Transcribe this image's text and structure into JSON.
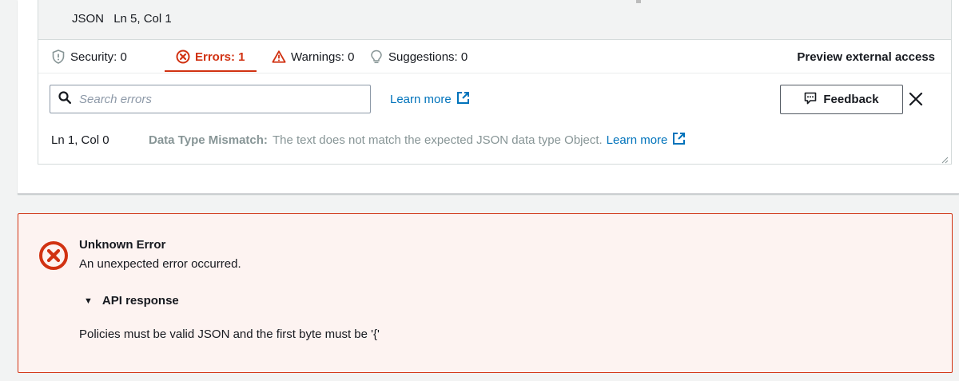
{
  "editor_status": {
    "language": "JSON",
    "cursor": "Ln 5, Col 1"
  },
  "tabs": [
    {
      "label": "Security: 0",
      "icon": "shield-icon"
    },
    {
      "label": "Errors: 1",
      "icon": "error-circle-icon",
      "active": true
    },
    {
      "label": "Warnings: 0",
      "icon": "warning-triangle-icon"
    },
    {
      "label": "Suggestions: 0",
      "icon": "lightbulb-icon"
    }
  ],
  "preview_external_access": "Preview external access",
  "search": {
    "placeholder": "Search errors",
    "value": ""
  },
  "learn_more": "Learn more",
  "feedback_label": "Feedback",
  "finding": {
    "location": "Ln 1, Col 0",
    "title": "Data Type Mismatch:",
    "message": "The text does not match the expected JSON data type Object.",
    "link": "Learn more"
  },
  "alert": {
    "title": "Unknown Error",
    "description": "An unexpected error occurred.",
    "expander_label": "API response",
    "api_message": "Policies must be valid JSON and the first byte must be '{'"
  },
  "colors": {
    "error_red": "#d13212",
    "link_blue": "#0073bb",
    "alert_bg": "#fdf3f1"
  }
}
